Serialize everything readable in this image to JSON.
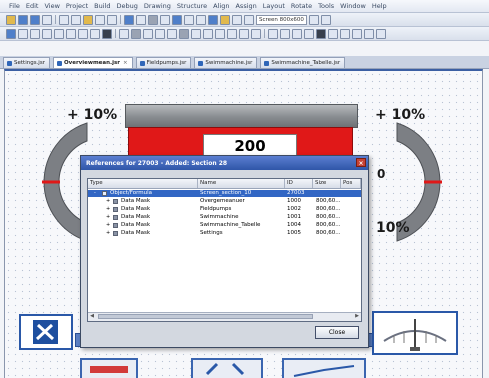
{
  "menu": [
    "File",
    "Edit",
    "View",
    "Project",
    "Build",
    "Debug",
    "Drawing",
    "Structure",
    "Align",
    "Assign",
    "Layout",
    "Rotate",
    "Tools",
    "Window",
    "Help"
  ],
  "toolbar": {
    "zoom_field": "Screen 800x600"
  },
  "tabs": [
    {
      "label": "Settings.jsr",
      "active": false
    },
    {
      "label": "Overviewmean.jsr",
      "active": true
    },
    {
      "label": "Fieldpumps.jsr",
      "active": false
    },
    {
      "label": "Swimmachine.jsr",
      "active": false
    },
    {
      "label": "Swimmachine_Tabelle.jsr",
      "active": false
    }
  ],
  "canvas": {
    "left_gauge_label": "+ 10%",
    "right_gauge_label": "+ 10%",
    "right_gauge_value": "0",
    "right_gauge_bottom_label": "10%",
    "tank_value": "200",
    "gauge_color": "#7c7f84",
    "indicator_color": "#e01818"
  },
  "dialog": {
    "title": "References for 27003 - Added: Section 28",
    "close_label": "Close",
    "columns": [
      "Type",
      "Name",
      "ID",
      "Size",
      "Pos"
    ],
    "rows": [
      {
        "expander": "-",
        "type": "Object/Formula",
        "name": "Screen_section_10",
        "id": "27003",
        "size": "",
        "selected": true
      },
      {
        "expander": "+",
        "type": "Data Mask",
        "name": "Overgemeanuer",
        "id": "1000",
        "size": "800,60...",
        "selected": false
      },
      {
        "expander": "+",
        "type": "Data Mask",
        "name": "Fieldpumps",
        "id": "1002",
        "size": "800,60...",
        "selected": false
      },
      {
        "expander": "+",
        "type": "Data Mask",
        "name": "Swimmachine",
        "id": "1001",
        "size": "800,60...",
        "selected": false
      },
      {
        "expander": "+",
        "type": "Data Mask",
        "name": "Swimmachine_Tabelle",
        "id": "1004",
        "size": "800,60...",
        "selected": false
      },
      {
        "expander": "+",
        "type": "Data Mask",
        "name": "Settings",
        "id": "1005",
        "size": "800,60...",
        "selected": false
      }
    ]
  }
}
